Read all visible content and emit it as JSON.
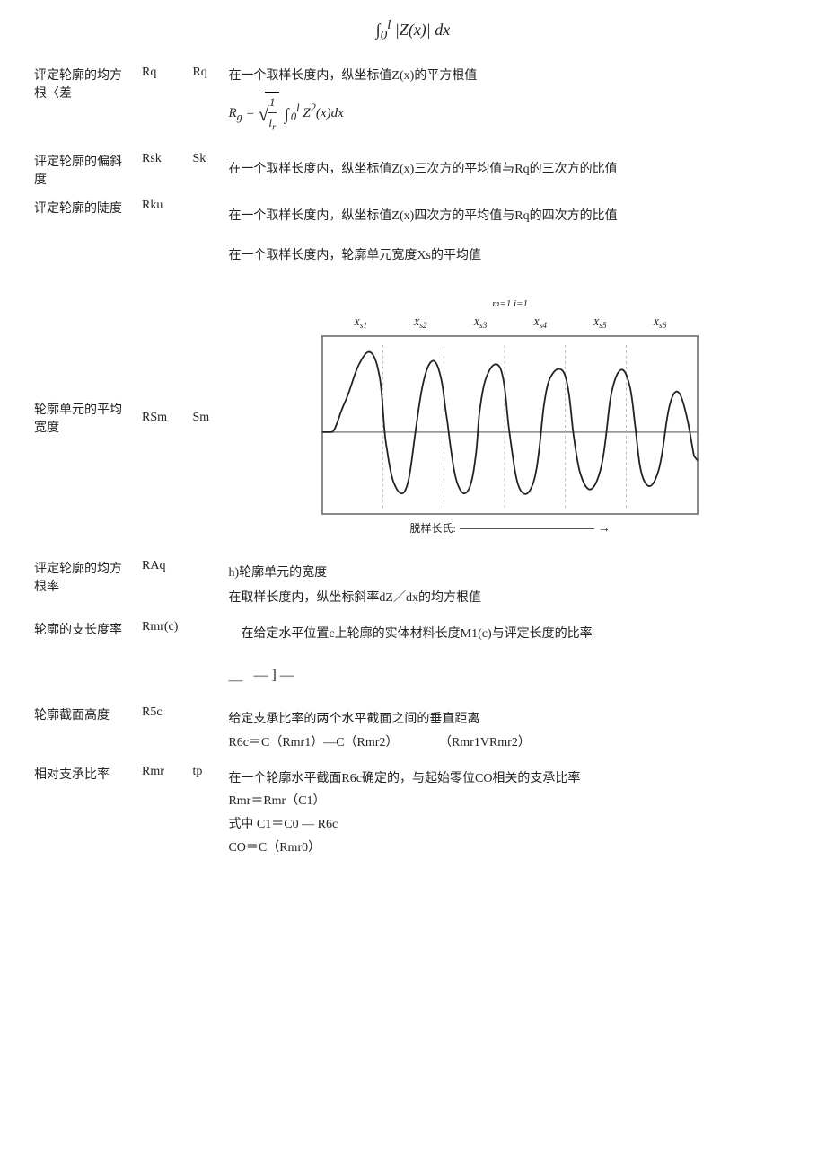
{
  "page": {
    "formula_top": "∫₀ˡ |Z(x)| dx",
    "rows": [
      {
        "name": "评定轮廓的均方根〈差",
        "sym1": "Rq",
        "sym2": "Rq",
        "desc_line1": "在一个取样长度内，纵坐标值Z(x)的平方根值",
        "formula": "Rq = √(1/lr · ∫₀ˡ Z²(x)dx)",
        "desc_line2": ""
      },
      {
        "name": "评定轮廓的偏斜度",
        "sym1": "Rsk",
        "sym2": "Sk",
        "desc_line1": "在一个取样长度内，纵坐标值Z(x)三次方的平均值与Rq的三次方的比值",
        "formula": "",
        "desc_line2": ""
      },
      {
        "name": "评定轮廓的陡度",
        "sym1": "Rku",
        "sym2": "",
        "desc_line1": "在一个取样长度内，纵坐标值Z(x)四次方的平均值与Rq的四次方的比值",
        "formula": "",
        "desc_line2": ""
      },
      {
        "name": "",
        "sym1": "",
        "sym2": "",
        "desc_line1": "在一个取样长度内，轮廓单元宽度Xs的平均值",
        "formula": "",
        "desc_line2": ""
      }
    ],
    "chart_section": {
      "name_label": "轮廓单元的平均宽度",
      "sym1": "RSm",
      "sym2": "Sm",
      "top_formula": "m=1  i=1",
      "x_labels": [
        "Xs1",
        "Xs2",
        "Xs3",
        "Xs4",
        "Xs5",
        "Xs6"
      ],
      "caption": "脱样长氏:"
    },
    "rows2": [
      {
        "name": "评定轮廓的均方根率",
        "sym1": "RAq",
        "sym2": "",
        "desc": "h)轮廓单元的宽度\n在取样长度内，纵坐标斜率dZ／dx的均方根值"
      },
      {
        "name": "轮廓的支长度率",
        "sym1": "Rmr(c)",
        "sym2": "",
        "desc": "在给定水平位置c上轮廓的实体材料长度M1(c)与评定长度的比率"
      },
      {
        "name": "",
        "sym1": "",
        "sym2": "",
        "desc": "＿ —]—"
      },
      {
        "name": "轮廓截面高度",
        "sym1": "R5c",
        "sym2": "",
        "desc": "给定支承比率的两个水平截面之间的垂直距离\nR6c＝C（Rmr1）—C（Rmr2）                    （Rmr1VRmr2）"
      },
      {
        "name": "相对支承比率",
        "sym1": "Rmr",
        "sym2": "tp",
        "desc": "在一个轮廓水平截面R6c确定的，与起始零位CO相关的支承比率\nRmr＝Rmr（C1）\n式中 C1＝C0 — R6c\nCO＝C（Rmr0）"
      }
    ]
  }
}
